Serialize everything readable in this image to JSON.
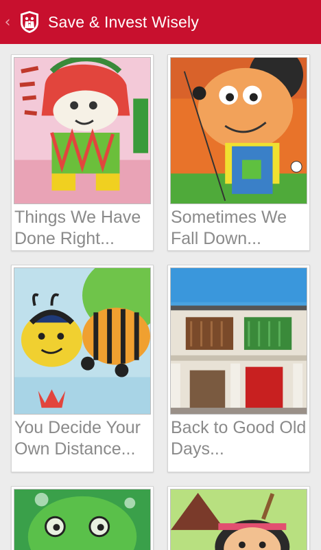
{
  "app": {
    "title": "Save & Invest Wisely",
    "accent": "#c8102e"
  },
  "icons": {
    "back": "back-chevron-icon",
    "logo": "family-shield-icon"
  },
  "tiles": [
    {
      "line1": "Things We Have",
      "line2": "Done Right...",
      "image": "lion-dance-drawing"
    },
    {
      "line1": "Sometimes We",
      "line2": "Fall Down...",
      "image": "mouse-character-drawing"
    },
    {
      "line1": "You Decide Your",
      "line2": "Own Distance...",
      "image": "bees-drawing"
    },
    {
      "line1": "Back to Good Old",
      "line2": "Days...",
      "image": "shophouse-photo"
    },
    {
      "line1": "",
      "line2": "",
      "image": "frog-drawing"
    },
    {
      "line1": "",
      "line2": "",
      "image": "native-girl-drawing"
    }
  ]
}
